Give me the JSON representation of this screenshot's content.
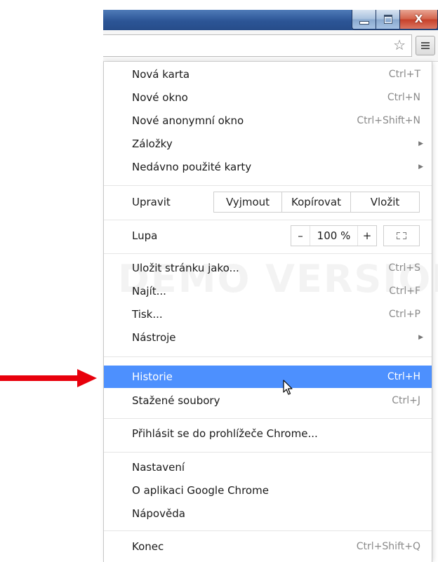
{
  "window": {
    "controls": {
      "close_glyph": "X"
    }
  },
  "toolbar": {
    "star_glyph": "☆",
    "menu_icon": "hamburger-icon"
  },
  "watermark": "DEMO VERSION",
  "menu": {
    "new_tab": {
      "label": "Nová karta",
      "shortcut": "Ctrl+T"
    },
    "new_window": {
      "label": "Nové okno",
      "shortcut": "Ctrl+N"
    },
    "new_incognito": {
      "label": "Nové anonymní okno",
      "shortcut": "Ctrl+Shift+N"
    },
    "bookmarks": {
      "label": "Záložky",
      "arrow": "▶"
    },
    "recent_tabs": {
      "label": "Nedávno použité karty",
      "arrow": "▶"
    },
    "edit": {
      "label": "Upravit",
      "cut": "Vyjmout",
      "copy": "Kopírovat",
      "paste": "Vložit"
    },
    "zoom": {
      "label": "Lupa",
      "minus": "–",
      "value": "100 %",
      "plus": "+"
    },
    "save_page": {
      "label": "Uložit stránku jako...",
      "shortcut": "Ctrl+S"
    },
    "find": {
      "label": "Najít...",
      "shortcut": "Ctrl+F"
    },
    "print": {
      "label": "Tisk...",
      "shortcut": "Ctrl+P"
    },
    "tools": {
      "label": "Nástroje",
      "arrow": "▶"
    },
    "history": {
      "label": "Historie",
      "shortcut": "Ctrl+H"
    },
    "downloads": {
      "label": "Stažené soubory",
      "shortcut": "Ctrl+J"
    },
    "signin": {
      "label": "Přihlásit se do prohlížeče Chrome..."
    },
    "settings": {
      "label": "Nastavení"
    },
    "about": {
      "label": "O aplikaci Google Chrome"
    },
    "help": {
      "label": "Nápověda"
    },
    "exit": {
      "label": "Konec",
      "shortcut": "Ctrl+Shift+Q"
    }
  },
  "colors": {
    "highlight": "#4d90fe",
    "annotation_arrow": "#e8000c",
    "titlebar": "#2c5596"
  }
}
